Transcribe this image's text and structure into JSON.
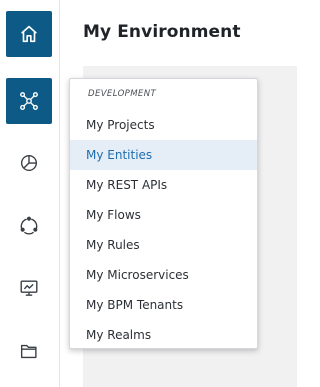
{
  "header": {
    "title": "My Environment"
  },
  "rail": {
    "items": [
      {
        "icon": "home-icon",
        "active": true
      },
      {
        "icon": "network-icon",
        "active": true
      },
      {
        "icon": "pie-chart-icon",
        "active": false
      },
      {
        "icon": "cycle-icon",
        "active": false
      },
      {
        "icon": "monitor-chart-icon",
        "active": false
      },
      {
        "icon": "folder-icon",
        "active": false
      }
    ]
  },
  "menu": {
    "section_label": "DEVELOPMENT",
    "selected": "My Entities",
    "items": [
      {
        "label": "My Projects"
      },
      {
        "label": "My Entities"
      },
      {
        "label": "My REST APIs"
      },
      {
        "label": "My Flows"
      },
      {
        "label": "My Rules"
      },
      {
        "label": "My Microservices"
      },
      {
        "label": "My BPM Tenants"
      },
      {
        "label": "My Realms"
      }
    ]
  },
  "colors": {
    "rail_active": "#0e5a86",
    "selected_bg": "#e5eef6",
    "selected_text": "#1f6db0",
    "content_bg": "#f1f1f1"
  }
}
